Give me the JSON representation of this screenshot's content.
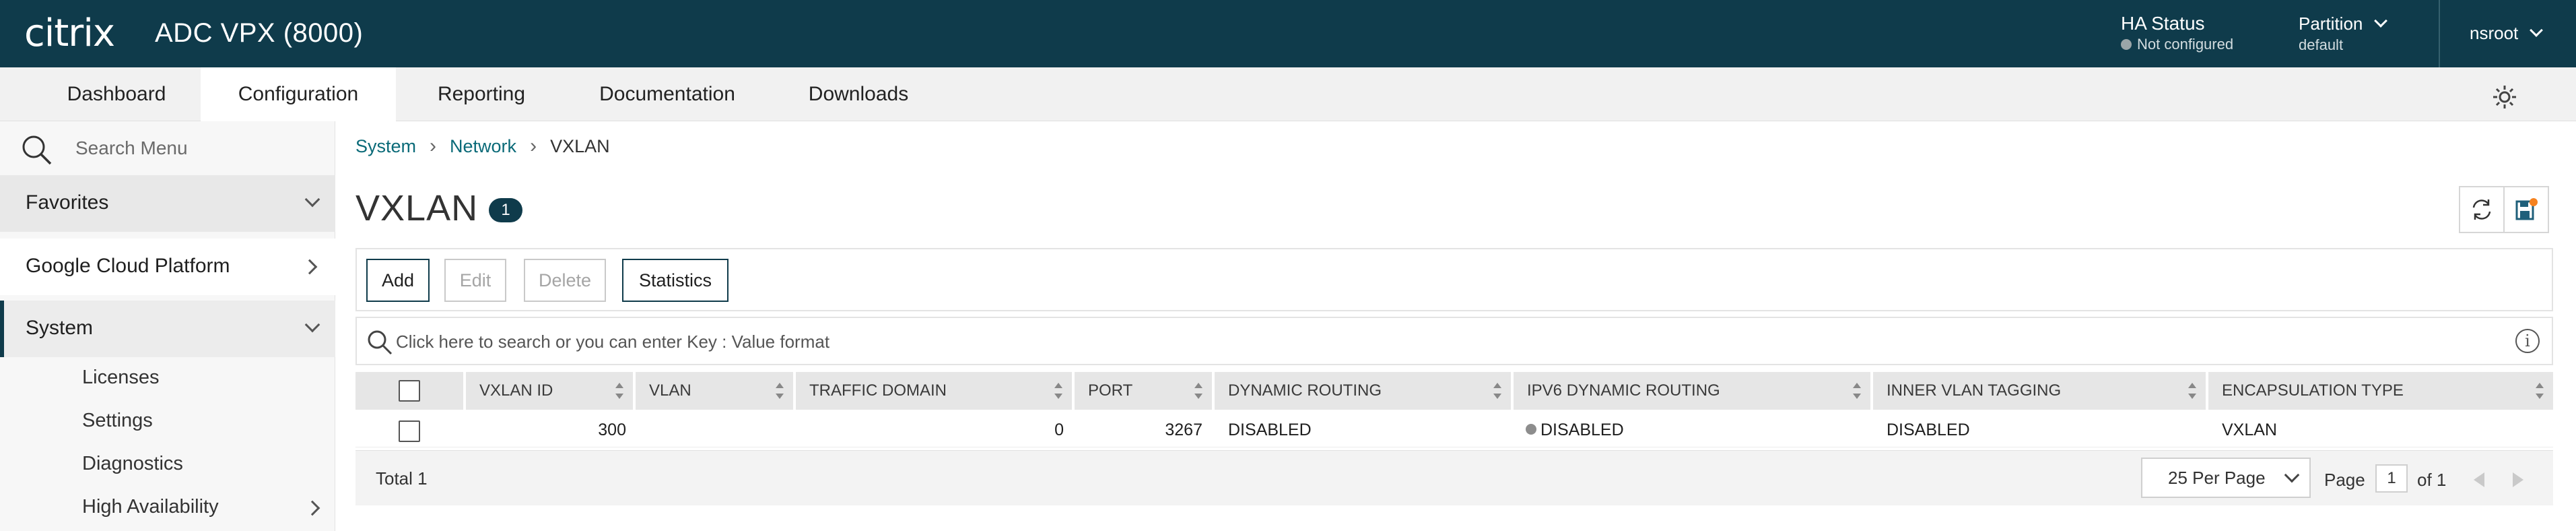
{
  "header": {
    "logo": "citrix",
    "app_title": "ADC VPX (8000)",
    "ha_status_label": "HA Status",
    "ha_status_value": "Not configured",
    "partition_label": "Partition",
    "partition_value": "default",
    "user": "nsroot"
  },
  "tabs": [
    {
      "label": "Dashboard",
      "active": false
    },
    {
      "label": "Configuration",
      "active": true
    },
    {
      "label": "Reporting",
      "active": false
    },
    {
      "label": "Documentation",
      "active": false
    },
    {
      "label": "Downloads",
      "active": false
    }
  ],
  "sidebar": {
    "search_placeholder": "Search Menu",
    "sections": [
      {
        "label": "Favorites",
        "state": "collapsed"
      },
      {
        "label": "Google Cloud Platform",
        "state": "link"
      },
      {
        "label": "System",
        "state": "expanded"
      }
    ],
    "system_items": [
      {
        "label": "Licenses"
      },
      {
        "label": "Settings"
      },
      {
        "label": "Diagnostics"
      },
      {
        "label": "High Availability"
      }
    ]
  },
  "breadcrumb": {
    "items": [
      "System",
      "Network",
      "VXLAN"
    ]
  },
  "page": {
    "title": "VXLAN",
    "count": "1"
  },
  "toolbar": {
    "add": "Add",
    "edit": "Edit",
    "delete": "Delete",
    "statistics": "Statistics"
  },
  "search": {
    "placeholder": "Click here to search or you can enter Key : Value format",
    "info_icon": "i"
  },
  "table": {
    "columns": [
      "VXLAN ID",
      "VLAN",
      "TRAFFIC DOMAIN",
      "PORT",
      "DYNAMIC ROUTING",
      "IPV6 DYNAMIC ROUTING",
      "INNER VLAN TAGGING",
      "ENCAPSULATION TYPE"
    ],
    "rows": [
      {
        "vxlan_id": "300",
        "vlan": "",
        "traffic_domain": "0",
        "port": "3267",
        "dynamic_routing": "DISABLED",
        "ipv6_dynamic_routing": "DISABLED",
        "inner_vlan_tagging": "DISABLED",
        "encapsulation_type": "VXLAN"
      }
    ]
  },
  "footer": {
    "total": "Total 1",
    "per_page": "25 Per Page",
    "page_label": "Page",
    "page_value": "1",
    "page_of": "of 1"
  },
  "colors": {
    "brand_dark": "#0f3b4b",
    "link": "#0a6a78",
    "save_dot": "#f58220"
  }
}
